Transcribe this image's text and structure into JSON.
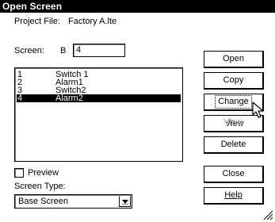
{
  "window": {
    "title": "Open Screen"
  },
  "project": {
    "label": "Project File:",
    "value": "Factory A.lte"
  },
  "screen": {
    "label": "Screen:",
    "type_letter": "B",
    "number": "4"
  },
  "screen_list": [
    {
      "number": "1",
      "name": "Switch 1",
      "selected": false
    },
    {
      "number": "2",
      "name": "Alarm1",
      "selected": false
    },
    {
      "number": "3",
      "name": "Switch2",
      "selected": false
    },
    {
      "number": "4",
      "name": "Alarm2",
      "selected": true
    }
  ],
  "buttons": {
    "open": "Open",
    "copy": "Copy",
    "change": "Change",
    "view": "View",
    "delete": "Delete",
    "close": "Close",
    "help": "Help"
  },
  "preview": {
    "label": "Preview",
    "checked": false
  },
  "screen_type": {
    "label": "Screen Type:",
    "selected": "Base Screen"
  },
  "icons": {
    "cursor": "mouse-pointer-icon",
    "dropdown": "chevron-down-icon",
    "grip": "resize-grip-icon"
  }
}
